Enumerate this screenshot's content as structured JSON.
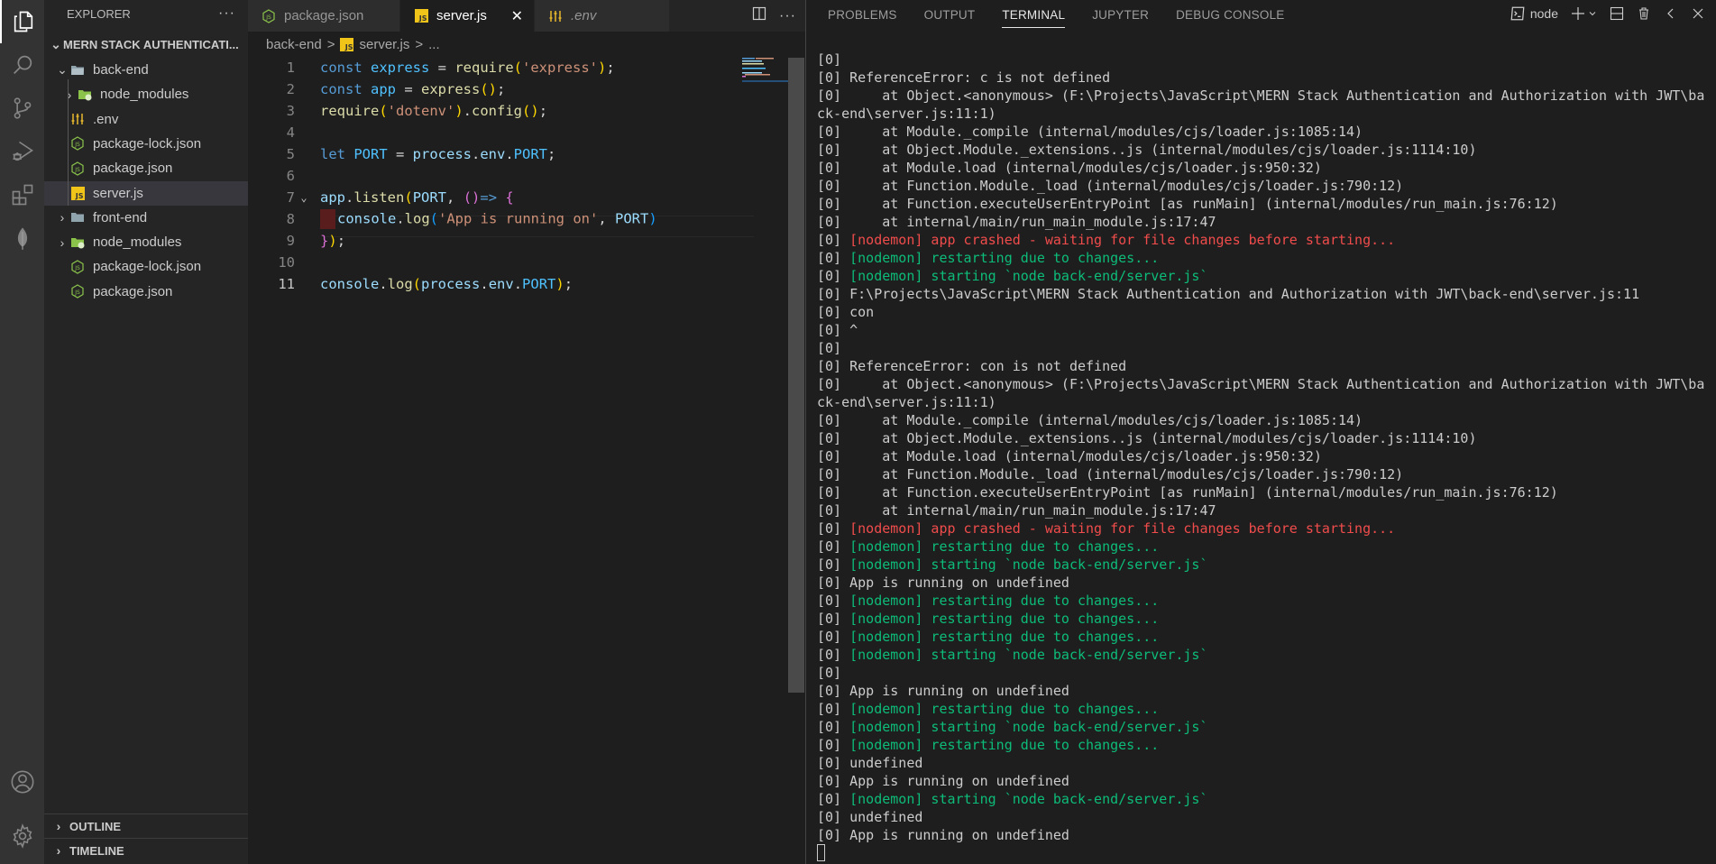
{
  "activity_bar": {
    "items": [
      {
        "name": "explorer",
        "icon": "files-icon",
        "active": true
      },
      {
        "name": "search",
        "icon": "search-icon"
      },
      {
        "name": "source-control",
        "icon": "source-control-icon"
      },
      {
        "name": "run-debug",
        "icon": "run-debug-icon"
      },
      {
        "name": "extensions",
        "icon": "extensions-icon"
      },
      {
        "name": "mongodb",
        "icon": "leaf-icon"
      }
    ],
    "bottom": [
      {
        "name": "accounts",
        "icon": "account-icon"
      },
      {
        "name": "manage",
        "icon": "gear-icon"
      }
    ]
  },
  "sidebar": {
    "title": "EXPLORER",
    "more": "···",
    "root": "MERN STACK AUTHENTICATI...",
    "tree": [
      {
        "label": "back-end",
        "type": "folder-open",
        "depth": 1,
        "expanded": true
      },
      {
        "label": "node_modules",
        "type": "node-folder",
        "depth": 2,
        "expanded": false
      },
      {
        "label": ".env",
        "type": "env",
        "depth": 2
      },
      {
        "label": "package-lock.json",
        "type": "node-json",
        "depth": 2
      },
      {
        "label": "package.json",
        "type": "node-json",
        "depth": 2
      },
      {
        "label": "server.js",
        "type": "js",
        "depth": 2,
        "selected": true
      },
      {
        "label": "front-end",
        "type": "folder",
        "depth": 1,
        "expanded": false
      },
      {
        "label": "node_modules",
        "type": "node-folder",
        "depth": 1,
        "expanded": false
      },
      {
        "label": "package-lock.json",
        "type": "node-json",
        "depth": 1
      },
      {
        "label": "package.json",
        "type": "node-json",
        "depth": 1
      }
    ],
    "sections": [
      "OUTLINE",
      "TIMELINE"
    ]
  },
  "editor": {
    "tabs": [
      {
        "label": "package.json",
        "icon": "node-json"
      },
      {
        "label": "server.js",
        "icon": "js",
        "active": true,
        "close": "✕"
      },
      {
        "label": ".env",
        "icon": "env",
        "preview": true
      }
    ],
    "breadcrumb": [
      "back-end",
      "server.js",
      "..."
    ],
    "breadcrumb_sep": ">",
    "js_badge": "JS",
    "lines": [
      {
        "n": "1",
        "tokens": [
          [
            "k",
            "const "
          ],
          [
            "v",
            "express"
          ],
          [
            "w",
            " = "
          ],
          [
            "f",
            "require"
          ],
          [
            "p1",
            "("
          ],
          [
            "s",
            "'express'"
          ],
          [
            "p1",
            ")"
          ],
          [
            "w",
            ";"
          ]
        ]
      },
      {
        "n": "2",
        "tokens": [
          [
            "k",
            "const "
          ],
          [
            "v",
            "app"
          ],
          [
            "w",
            " = "
          ],
          [
            "f",
            "express"
          ],
          [
            "p1",
            "()"
          ],
          [
            "w",
            ";"
          ]
        ]
      },
      {
        "n": "3",
        "tokens": [
          [
            "f",
            "require"
          ],
          [
            "p1",
            "("
          ],
          [
            "s",
            "'dotenv'"
          ],
          [
            "p1",
            ")"
          ],
          [
            "w",
            "."
          ],
          [
            "f",
            "config"
          ],
          [
            "p1",
            "()"
          ],
          [
            "w",
            ";"
          ]
        ]
      },
      {
        "n": "4",
        "tokens": []
      },
      {
        "n": "5",
        "tokens": [
          [
            "k",
            "let "
          ],
          [
            "v",
            "PORT"
          ],
          [
            "w",
            " = "
          ],
          [
            "vf",
            "process"
          ],
          [
            "w",
            "."
          ],
          [
            "vf",
            "env"
          ],
          [
            "w",
            "."
          ],
          [
            "v",
            "PORT"
          ],
          [
            "w",
            ";"
          ]
        ]
      },
      {
        "n": "6",
        "tokens": []
      },
      {
        "n": "7",
        "fold": "⌄",
        "tokens": [
          [
            "vf",
            "app"
          ],
          [
            "w",
            "."
          ],
          [
            "f",
            "listen"
          ],
          [
            "p1",
            "("
          ],
          [
            "vf",
            "PORT"
          ],
          [
            "w",
            ", "
          ],
          [
            "p2",
            "()"
          ],
          [
            "k",
            "=>"
          ],
          [
            "w",
            " "
          ],
          [
            "p2",
            "{"
          ]
        ]
      },
      {
        "n": "8",
        "error": true,
        "tokens": [
          [
            "vf",
            "console"
          ],
          [
            "w",
            "."
          ],
          [
            "f",
            "log"
          ],
          [
            "p3",
            "("
          ],
          [
            "s",
            "'App is running on'"
          ],
          [
            "w",
            ", "
          ],
          [
            "vf",
            "PORT"
          ],
          [
            "p3",
            ")"
          ]
        ]
      },
      {
        "n": "9",
        "tokens": [
          [
            "p2",
            "}"
          ],
          [
            "p1",
            ")"
          ],
          [
            "w",
            ";"
          ]
        ]
      },
      {
        "n": "10",
        "tokens": []
      },
      {
        "n": "11",
        "current": true,
        "tokens": [
          [
            "vf",
            "console"
          ],
          [
            "w",
            "."
          ],
          [
            "f",
            "log"
          ],
          [
            "p1",
            "("
          ],
          [
            "vf",
            "process"
          ],
          [
            "w",
            "."
          ],
          [
            "vf",
            "env"
          ],
          [
            "w",
            "."
          ],
          [
            "v",
            "PORT"
          ],
          [
            "p1",
            ")"
          ],
          [
            "w",
            ";"
          ]
        ]
      }
    ]
  },
  "panel": {
    "tabs": [
      "PROBLEMS",
      "OUTPUT",
      "TERMINAL",
      "JUPYTER",
      "DEBUG CONSOLE"
    ],
    "active_tab": "TERMINAL",
    "terminal_name": "node",
    "actions": [
      "terminal-icon",
      "plus-icon",
      "chevron-down-icon",
      "split-icon",
      "trash-icon",
      "chevron-left-icon",
      "close-icon"
    ],
    "terminal_lines": [
      {
        "prefix": "[0]",
        "text": ""
      },
      {
        "prefix": "[0]",
        "text": " ReferenceError: c is not defined"
      },
      {
        "prefix": "[0]",
        "text": "     at Object.<anonymous> (F:\\Projects\\JavaScript\\MERN Stack Authentication and Authorization with JWT\\back-end\\server.js:11:1)",
        "wrap": true
      },
      {
        "prefix": "[0]",
        "text": "     at Module._compile (internal/modules/cjs/loader.js:1085:14)"
      },
      {
        "prefix": "[0]",
        "text": "     at Object.Module._extensions..js (internal/modules/cjs/loader.js:1114:10)"
      },
      {
        "prefix": "[0]",
        "text": "     at Module.load (internal/modules/cjs/loader.js:950:32)"
      },
      {
        "prefix": "[0]",
        "text": "     at Function.Module._load (internal/modules/cjs/loader.js:790:12)"
      },
      {
        "prefix": "[0]",
        "text": "     at Function.executeUserEntryPoint [as runMain] (internal/modules/run_main.js:76:12)"
      },
      {
        "prefix": "[0]",
        "text": "     at internal/main/run_main_module.js:17:47"
      },
      {
        "prefix": "[0]",
        "text": " [nodemon] app crashed - waiting for file changes before starting...",
        "color": "red"
      },
      {
        "prefix": "[0]",
        "text": " [nodemon] restarting due to changes...",
        "color": "green"
      },
      {
        "prefix": "[0]",
        "text": " [nodemon] starting `node back-end/server.js`",
        "color": "green"
      },
      {
        "prefix": "[0]",
        "text": " F:\\Projects\\JavaScript\\MERN Stack Authentication and Authorization with JWT\\back-end\\server.js:11"
      },
      {
        "prefix": "[0]",
        "text": " con"
      },
      {
        "prefix": "[0]",
        "text": " ^"
      },
      {
        "prefix": "[0]",
        "text": ""
      },
      {
        "prefix": "[0]",
        "text": " ReferenceError: con is not defined"
      },
      {
        "prefix": "[0]",
        "text": "     at Object.<anonymous> (F:\\Projects\\JavaScript\\MERN Stack Authentication and Authorization with JWT\\back-end\\server.js:11:1)",
        "wrap": true
      },
      {
        "prefix": "[0]",
        "text": "     at Module._compile (internal/modules/cjs/loader.js:1085:14)"
      },
      {
        "prefix": "[0]",
        "text": "     at Object.Module._extensions..js (internal/modules/cjs/loader.js:1114:10)"
      },
      {
        "prefix": "[0]",
        "text": "     at Module.load (internal/modules/cjs/loader.js:950:32)"
      },
      {
        "prefix": "[0]",
        "text": "     at Function.Module._load (internal/modules/cjs/loader.js:790:12)"
      },
      {
        "prefix": "[0]",
        "text": "     at Function.executeUserEntryPoint [as runMain] (internal/modules/run_main.js:76:12)"
      },
      {
        "prefix": "[0]",
        "text": "     at internal/main/run_main_module.js:17:47"
      },
      {
        "prefix": "[0]",
        "text": " [nodemon] app crashed - waiting for file changes before starting...",
        "color": "red"
      },
      {
        "prefix": "[0]",
        "text": " [nodemon] restarting due to changes...",
        "color": "green"
      },
      {
        "prefix": "[0]",
        "text": " [nodemon] starting `node back-end/server.js`",
        "color": "green"
      },
      {
        "prefix": "[0]",
        "text": " App is running on undefined"
      },
      {
        "prefix": "[0]",
        "text": " [nodemon] restarting due to changes...",
        "color": "green"
      },
      {
        "prefix": "[0]",
        "text": " [nodemon] restarting due to changes...",
        "color": "green"
      },
      {
        "prefix": "[0]",
        "text": " [nodemon] restarting due to changes...",
        "color": "green"
      },
      {
        "prefix": "[0]",
        "text": " [nodemon] starting `node back-end/server.js`",
        "color": "green"
      },
      {
        "prefix": "[0]",
        "text": ""
      },
      {
        "prefix": "[0]",
        "text": " App is running on undefined"
      },
      {
        "prefix": "[0]",
        "text": " [nodemon] restarting due to changes...",
        "color": "green"
      },
      {
        "prefix": "[0]",
        "text": " [nodemon] starting `node back-end/server.js`",
        "color": "green"
      },
      {
        "prefix": "[0]",
        "text": " [nodemon] restarting due to changes...",
        "color": "green"
      },
      {
        "prefix": "[0]",
        "text": " undefined"
      },
      {
        "prefix": "[0]",
        "text": " App is running on undefined"
      },
      {
        "prefix": "[0]",
        "text": " [nodemon] starting `node back-end/server.js`",
        "color": "green"
      },
      {
        "prefix": "[0]",
        "text": " undefined"
      },
      {
        "prefix": "[0]",
        "text": " App is running on undefined"
      }
    ]
  },
  "colors": {
    "accent_js": "#f0c419",
    "node_green": "#8bc34a",
    "error_red": "#f14c4c",
    "nodemon_green": "#23d18b"
  }
}
